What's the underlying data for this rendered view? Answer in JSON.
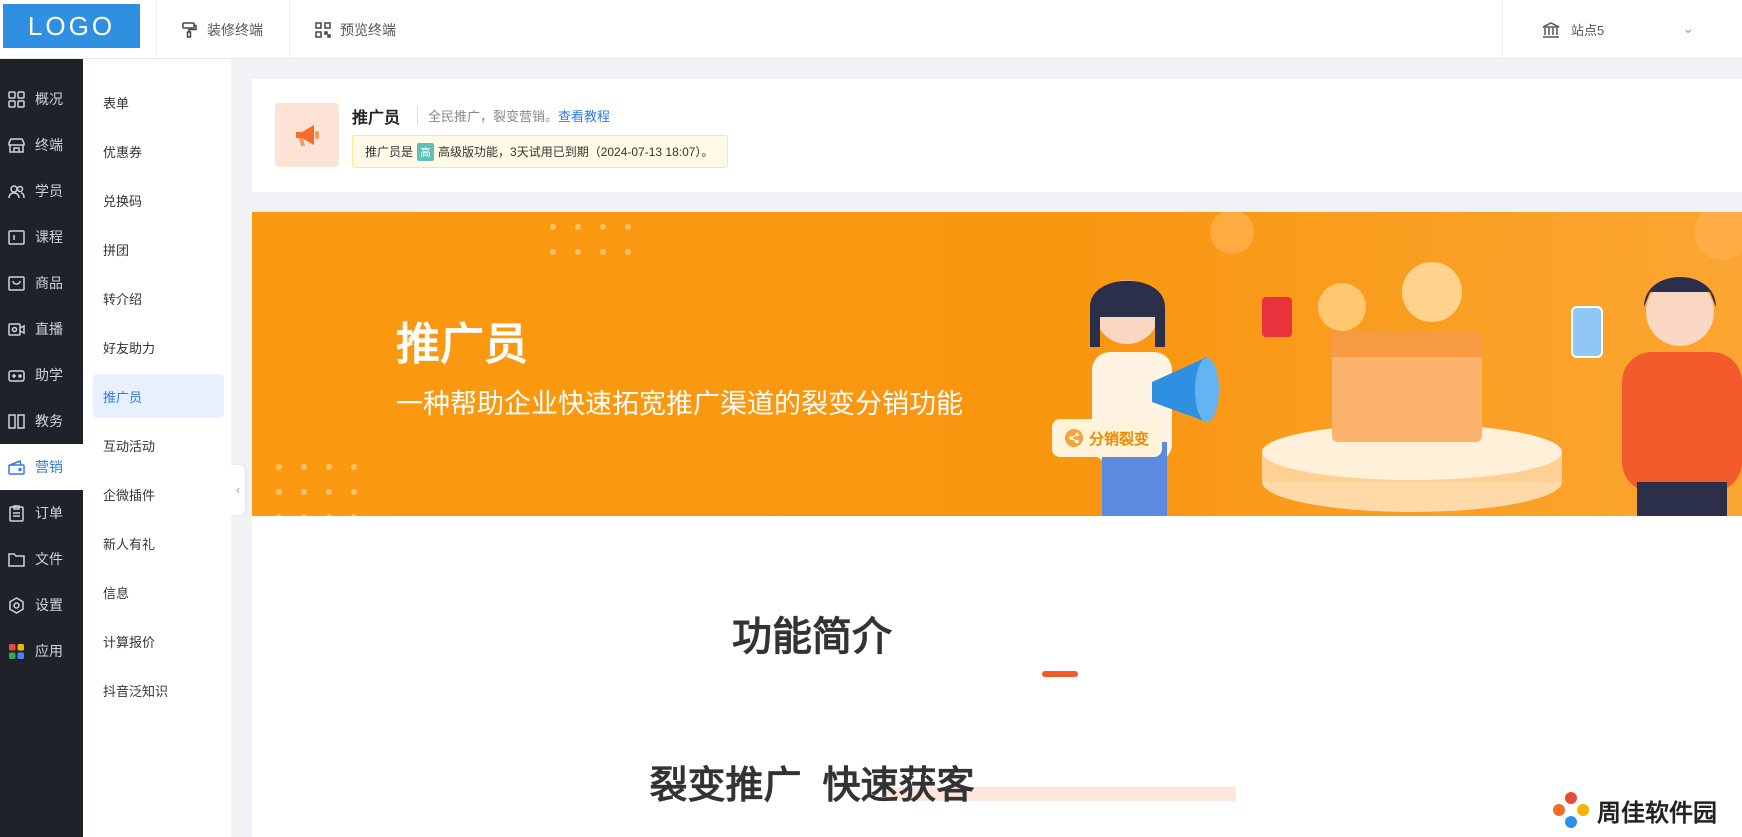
{
  "topbar": {
    "logo": "LOGO",
    "decorate_label": "装修终端",
    "preview_label": "预览终端",
    "site_label": "站点5"
  },
  "rail": {
    "items": [
      {
        "label": "概况",
        "icon": "grid-icon"
      },
      {
        "label": "终端",
        "icon": "store-icon"
      },
      {
        "label": "学员",
        "icon": "users-icon"
      },
      {
        "label": "课程",
        "icon": "course-icon"
      },
      {
        "label": "商品",
        "icon": "bag-icon"
      },
      {
        "label": "直播",
        "icon": "video-icon"
      },
      {
        "label": "助学",
        "icon": "gamepad-icon"
      },
      {
        "label": "教务",
        "icon": "book-icon"
      },
      {
        "label": "营销",
        "icon": "wallet-icon",
        "active": true
      },
      {
        "label": "订单",
        "icon": "clipboard-icon"
      },
      {
        "label": "文件",
        "icon": "folder-icon"
      },
      {
        "label": "设置",
        "icon": "gear-icon"
      },
      {
        "label": "应用",
        "icon": "apps-icon"
      }
    ]
  },
  "submenu": {
    "items": [
      "表单",
      "优惠券",
      "兑换码",
      "拼团",
      "转介绍",
      "好友助力",
      "推广员",
      "互动活动",
      "企微插件",
      "新人有礼",
      "信息",
      "计算报价",
      "抖音泛知识"
    ],
    "active": "推广员"
  },
  "header": {
    "title": "推广员",
    "desc": "全民推广，裂变营销。",
    "link": "查看教程",
    "notice_prefix": "推广员是",
    "notice_badge": "高",
    "notice_text": "高级版功能，3天试用已到期（2024-07-13 18:07）。"
  },
  "banner": {
    "title": "推广员",
    "subtitle": "一种帮助企业快速拓宽推广渠道的裂变分销功能",
    "pill": "分销裂变"
  },
  "intro": {
    "title": "功能简介",
    "slogan": "裂变推广  快速获客"
  },
  "watermark": "周佳软件园",
  "colors": {
    "accent": "#2f7be5",
    "banner": "#fb9a10",
    "rail": "#1f2329"
  }
}
